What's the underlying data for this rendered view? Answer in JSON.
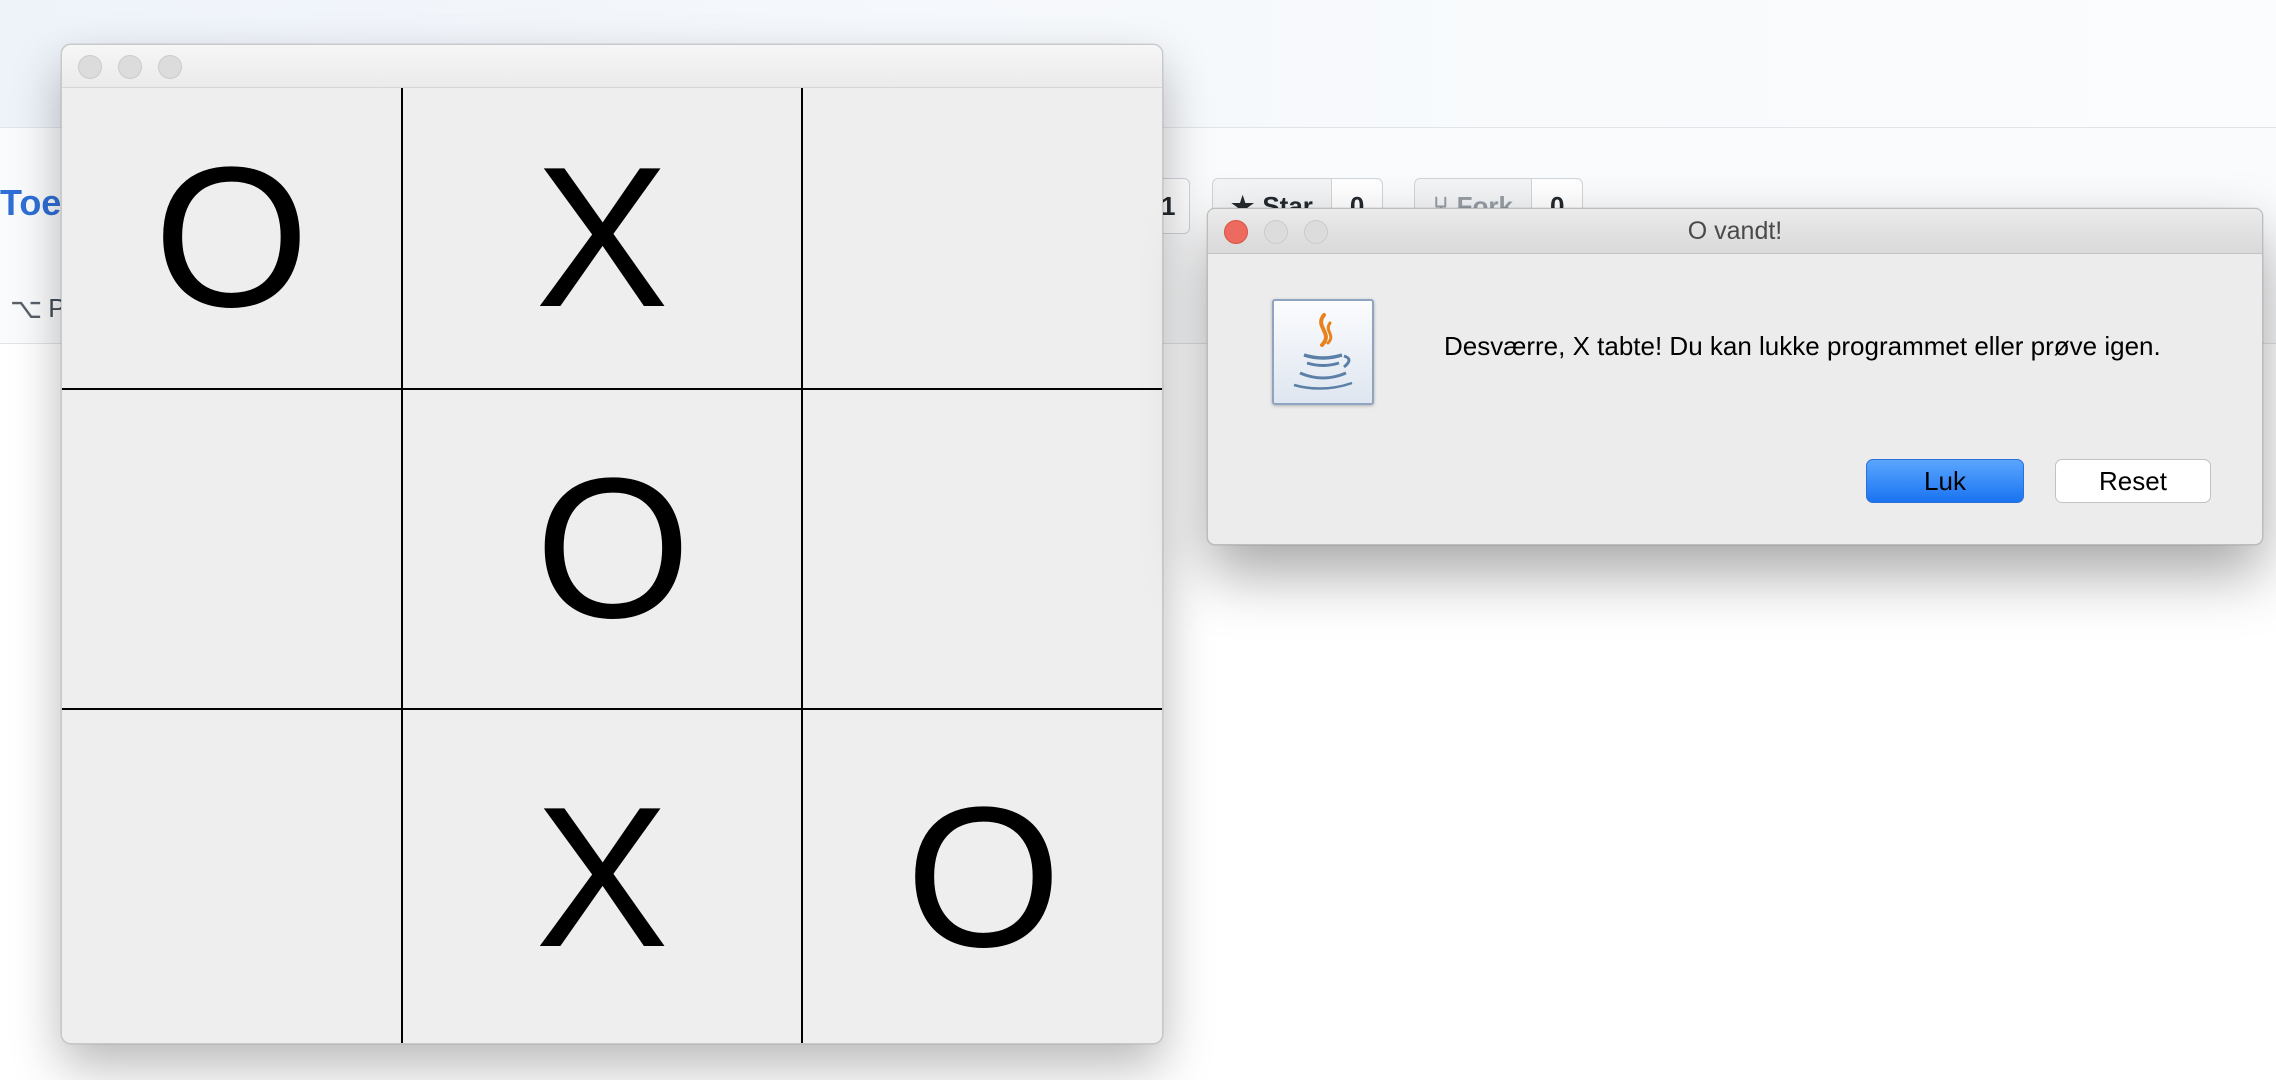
{
  "background": {
    "repo_name": "Toe",
    "tab_label": "P",
    "watch_count": "1",
    "star_label": "Star",
    "star_count": "0",
    "fork_label": "Fork",
    "fork_count": "0"
  },
  "game": {
    "board": [
      [
        "O",
        "X",
        ""
      ],
      [
        "",
        "O",
        ""
      ],
      [
        "",
        "X",
        "O"
      ]
    ]
  },
  "dialog": {
    "title": "O vandt!",
    "message": "Desværre, X tabte! Du kan lukke programmet eller prøve igen.",
    "buttons": {
      "primary": "Luk",
      "secondary": "Reset"
    },
    "icon": "java-icon"
  },
  "colors": {
    "link_blue": "#2f6fd6",
    "close_red": "#ed6a5e",
    "primary_button": "#1a73f0",
    "window_bg": "#ececec"
  }
}
